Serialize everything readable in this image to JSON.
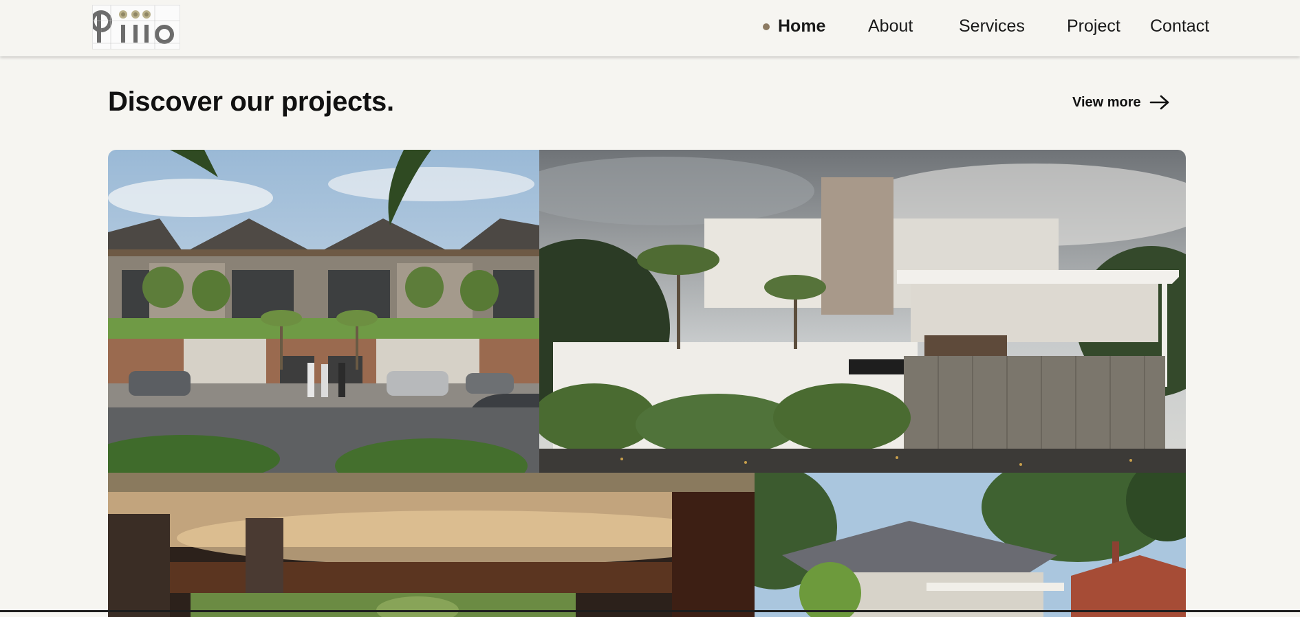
{
  "brand": {
    "logo_text": "biiio"
  },
  "nav": {
    "items": [
      {
        "label": "Home",
        "active": true
      },
      {
        "label": "About",
        "active": false
      },
      {
        "label": "Services",
        "active": false
      },
      {
        "label": "Project",
        "active": false
      },
      {
        "label": "Contact",
        "active": false
      }
    ],
    "active_dot_color": "#8c7a62"
  },
  "section": {
    "title": "Discover our projects.",
    "view_more_label": "View more",
    "view_more_icon": "arrow-right-icon"
  },
  "projects": [
    {
      "image": "townhouse-row-rendering"
    },
    {
      "image": "modern-white-villa-rendering"
    },
    {
      "image": "wooden-pavilion-interior-rendering"
    },
    {
      "image": "hip-roof-house-rendering"
    }
  ],
  "colors": {
    "background": "#f6f5f1",
    "text": "#111111",
    "accent": "#8c7a62"
  }
}
